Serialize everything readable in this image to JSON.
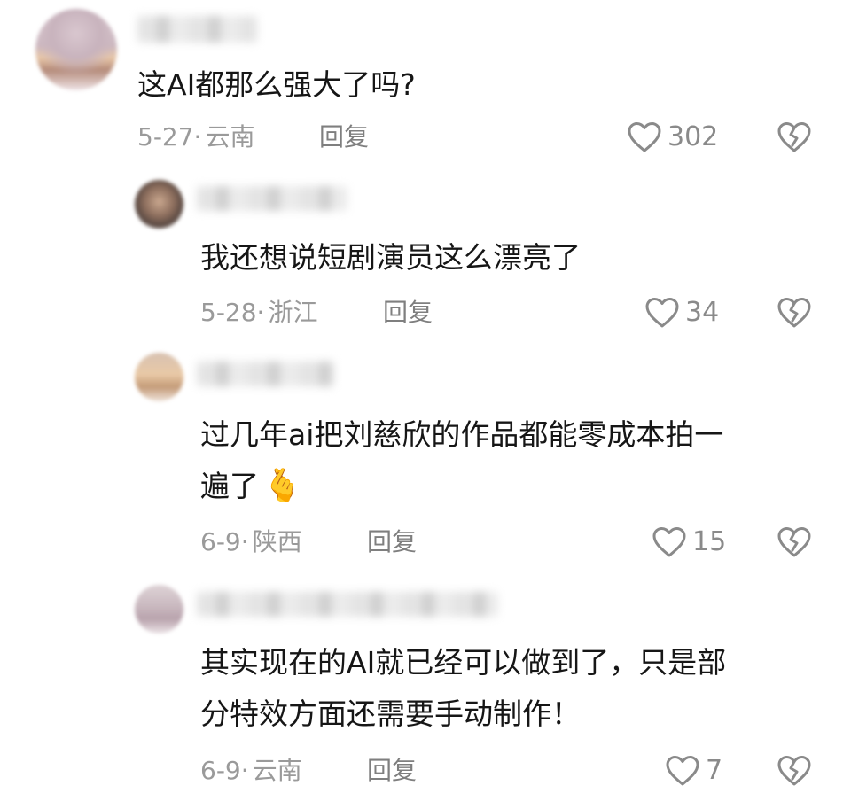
{
  "comments": [
    {
      "text_lines": [
        "这AI都那么强大了吗?"
      ],
      "date": "5-27",
      "sep": "·",
      "location": "云南",
      "reply_label": "回复",
      "likes": "302"
    },
    {
      "text_lines": [
        "我还想说短剧演员这么漂亮了"
      ],
      "date": "5-28",
      "sep": "·",
      "location": "浙江",
      "reply_label": "回复",
      "likes": "34"
    },
    {
      "text_lines": [
        "过几年ai把刘慈欣的作品都能零成本拍一",
        "遍了"
      ],
      "emoji": "🫰",
      "date": "6-9",
      "sep": "·",
      "location": "陕西",
      "reply_label": "回复",
      "likes": "15"
    },
    {
      "text_lines": [
        "其实现在的AI就已经可以做到了，只是部",
        "分特效方面还需要手动制作！"
      ],
      "date": "6-9",
      "sep": "·",
      "location": "云南",
      "reply_label": "回复",
      "likes": "7"
    }
  ],
  "icons": {
    "like": "heart-outline-icon",
    "dislike": "broken-heart-icon"
  },
  "colors": {
    "text": "#161616",
    "meta": "#9a9a9a",
    "icon": "#8a8a8a"
  }
}
